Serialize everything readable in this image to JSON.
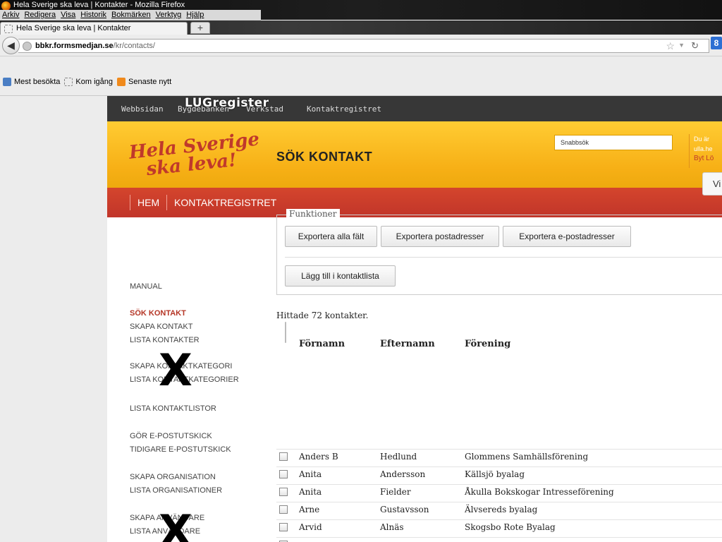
{
  "browser": {
    "window_title": "Hela Sverige ska leva | Kontakter - Mozilla Firefox",
    "menu": [
      "Arkiv",
      "Redigera",
      "Visa",
      "Historik",
      "Bokmärken",
      "Verktyg",
      "Hjälp"
    ],
    "tab_title": "Hela Sverige ska leva | Kontakter",
    "new_tab": "+",
    "url_host": "bbkr.formsmedjan.se",
    "url_path": "/kr/contacts/",
    "bookmarks": [
      "Mest besökta",
      "Kom igång",
      "Senaste nytt"
    ],
    "search_engine_glyph": "8"
  },
  "site": {
    "topnav": [
      "Webbsidan",
      "Bygdebanken",
      "Verkstad",
      "Kontaktregistret"
    ],
    "overlay_label": "LUGregister",
    "logo_line1": "Hela Sverige",
    "logo_line2": "ska leva!",
    "quicksearch_value": "Snabbsök",
    "userinfo_line1": "Du är",
    "userinfo_line2": "ulla.he",
    "userinfo_link": "Byt Lö",
    "rednav": [
      "HEM",
      "KONTAKTREGISTRET"
    ]
  },
  "sidebar": {
    "manual": "MANUAL",
    "items": [
      "SÖK KONTAKT",
      "SKAPA KONTAKT",
      "LISTA KONTAKTER",
      "SKAPA KONTAKTKATEGORI",
      "LISTA KONTAKTKATEGORIER",
      "LISTA KONTAKTLISTOR",
      "GÖR E-POSTUTSKICK",
      "TIDIGARE E-POSTUTSKICK",
      "SKAPA ORGANISATION",
      "LISTA ORGANISATIONER",
      "SKAPA ANVÄNDARE",
      "LISTA ANVÄNDARE"
    ],
    "redaction_mark": "X"
  },
  "main": {
    "title": "SÖK KONTAKT",
    "vi_button": "Vi",
    "functions_legend": "Funktioner",
    "buttons": [
      "Exportera alla fält",
      "Exportera postadresser",
      "Exportera e-postadresser"
    ],
    "add_to_list": "Lägg till i kontaktlista",
    "result_text": "Hittade 72 kontakter.",
    "columns": [
      "Förnamn",
      "Efternamn",
      "Förening"
    ],
    "rows": [
      [
        "Anders B",
        "Hedlund",
        "Glommens Samhällsförening"
      ],
      [
        "Anita",
        "Andersson",
        "Källsjö byalag"
      ],
      [
        "Anita",
        "Fielder",
        "Åkulla Bokskogar Intresseförening"
      ],
      [
        "Arne",
        "Gustavsson",
        "Älvsereds byalag"
      ],
      [
        "Arvid",
        "Alnäs",
        "Skogsbo Rote Byalag"
      ]
    ]
  }
}
